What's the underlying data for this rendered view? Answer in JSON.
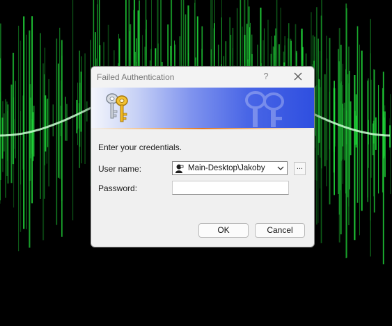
{
  "dialog": {
    "title": "Failed Authentication",
    "help_glyph": "?",
    "prompt": "Enter your credentials.",
    "username_label": "User name:",
    "username_value": "Main-Desktop\\Jakoby",
    "browse_label": "...",
    "password_label": "Password:",
    "password_value": "",
    "ok_label": "OK",
    "cancel_label": "Cancel"
  },
  "icons": {
    "help": "question-mark",
    "close": "close-x",
    "banner": "keys",
    "user": "user-avatar",
    "dropdown": "chevron-down"
  },
  "colors": {
    "wallpaper_wave": "#22e03c",
    "banner_blue": "#2f4fe0",
    "accent_orange": "#e07a25",
    "dialog_bg": "#f0f0f0"
  }
}
